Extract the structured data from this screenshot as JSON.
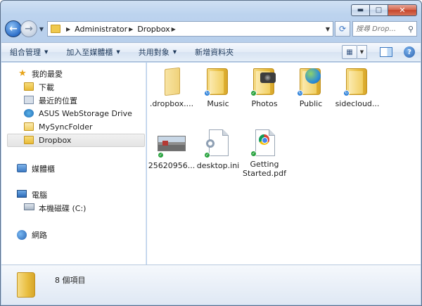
{
  "window": {
    "caption": {
      "minimize": "▬",
      "maximize": "□",
      "close": "✕"
    }
  },
  "address": {
    "crumbs": [
      "Administrator",
      "Dropbox"
    ],
    "search_placeholder": "搜尋 Drop..."
  },
  "toolbar": {
    "commands": [
      "組合管理",
      "加入至媒體櫃",
      "共用對象",
      "新增資料夾"
    ]
  },
  "sidebar": {
    "favorites": "我的最愛",
    "favorite_items": [
      "下載",
      "最近的位置",
      "ASUS WebStorage Drive",
      "MySyncFolder",
      "Dropbox"
    ],
    "libraries": "媒體櫃",
    "computer": "電腦",
    "computer_items": [
      "本機磁碟 (C:)"
    ],
    "network": "網路",
    "selected": "Dropbox"
  },
  "files": [
    {
      "label": ".dropbox....",
      "kind": "folder-hidden",
      "status": "none"
    },
    {
      "label": "Music",
      "kind": "folder",
      "status": "sync"
    },
    {
      "label": "Photos",
      "kind": "folder-camera",
      "status": "ok"
    },
    {
      "label": "Public",
      "kind": "folder-globe",
      "status": "sync"
    },
    {
      "label": "sidecloud...",
      "kind": "folder",
      "status": "sync"
    },
    {
      "label": "25620956...",
      "kind": "image",
      "status": "ok"
    },
    {
      "label": "desktop.ini",
      "kind": "ini",
      "status": "ok"
    },
    {
      "label": "Getting Started.pdf",
      "label_lines": [
        "Getting",
        "Started.pdf"
      ],
      "kind": "pdf-chrome",
      "status": "ok"
    }
  ],
  "details": {
    "item_count": "8 個項目"
  }
}
